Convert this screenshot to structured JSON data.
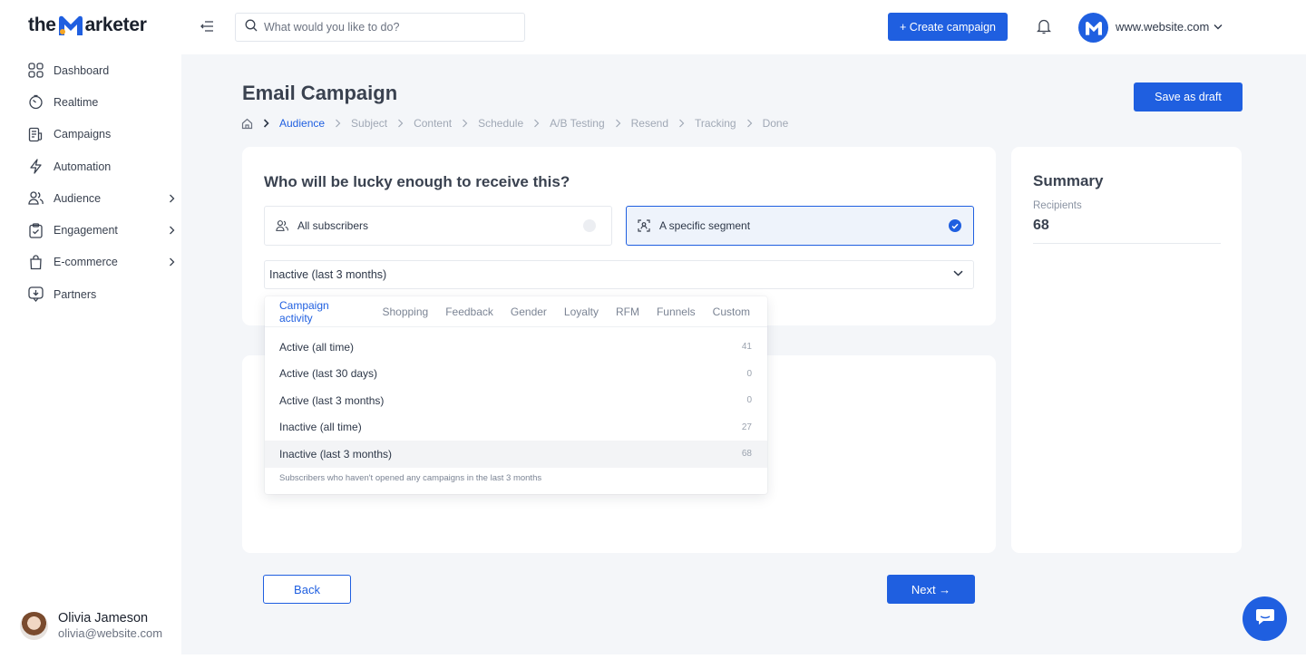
{
  "brand": {
    "logo_prefix": "the",
    "logo_letter": "M",
    "logo_suffix": "arketer",
    "accent_color": "#1f5fe0"
  },
  "sidebar": {
    "items": [
      {
        "label": "Dashboard",
        "icon": "grid-icon",
        "has_submenu": false
      },
      {
        "label": "Realtime",
        "icon": "timer-icon",
        "has_submenu": false
      },
      {
        "label": "Campaigns",
        "icon": "campaigns-icon",
        "has_submenu": false
      },
      {
        "label": "Automation",
        "icon": "lightning-icon",
        "has_submenu": false
      },
      {
        "label": "Audience",
        "icon": "users-icon",
        "has_submenu": true
      },
      {
        "label": "Engagement",
        "icon": "clipboard-icon",
        "has_submenu": true
      },
      {
        "label": "E-commerce",
        "icon": "shopping-bag-icon",
        "has_submenu": true
      },
      {
        "label": "Partners",
        "icon": "partners-icon",
        "has_submenu": false
      }
    ]
  },
  "profile": {
    "name": "Olivia Jameson",
    "email": "olivia@website.com"
  },
  "topbar": {
    "search_placeholder": "What would you like to do?",
    "create_label": "+ Create campaign",
    "site_name": "www.website.com"
  },
  "page": {
    "title": "Email Campaign",
    "save_draft_label": "Save as draft",
    "breadcrumb": [
      "Audience",
      "Subject",
      "Content",
      "Schedule",
      "A/B Testing",
      "Resend",
      "Tracking",
      "Done"
    ],
    "active_step": "Audience"
  },
  "audience": {
    "question": "Who will be lucky enough to receive this?",
    "option_all": "All subscribers",
    "option_segment": "A specific segment",
    "selected_option": "A specific segment",
    "selected_segment": "Inactive (last 3 months)"
  },
  "dropdown": {
    "tabs": [
      "Campaign activity",
      "Shopping",
      "Feedback",
      "Gender",
      "Loyalty",
      "RFM",
      "Funnels",
      "Custom"
    ],
    "active_tab": "Campaign activity",
    "rows": [
      {
        "label": "Active (all time)",
        "count": "41"
      },
      {
        "label": "Active (last 30 days)",
        "count": "0"
      },
      {
        "label": "Active (last 3 months)",
        "count": "0"
      },
      {
        "label": "Inactive (all time)",
        "count": "27"
      },
      {
        "label": "Inactive (last 3 months)",
        "count": "68"
      }
    ],
    "highlighted_row": "Inactive (last 3 months)",
    "description": "Subscribers who haven't opened any campaigns in the last 3 months"
  },
  "summary": {
    "title": "Summary",
    "recipients_label": "Recipients",
    "recipients_value": "68"
  },
  "footer": {
    "back_label": "Back",
    "next_label": "Next →"
  }
}
